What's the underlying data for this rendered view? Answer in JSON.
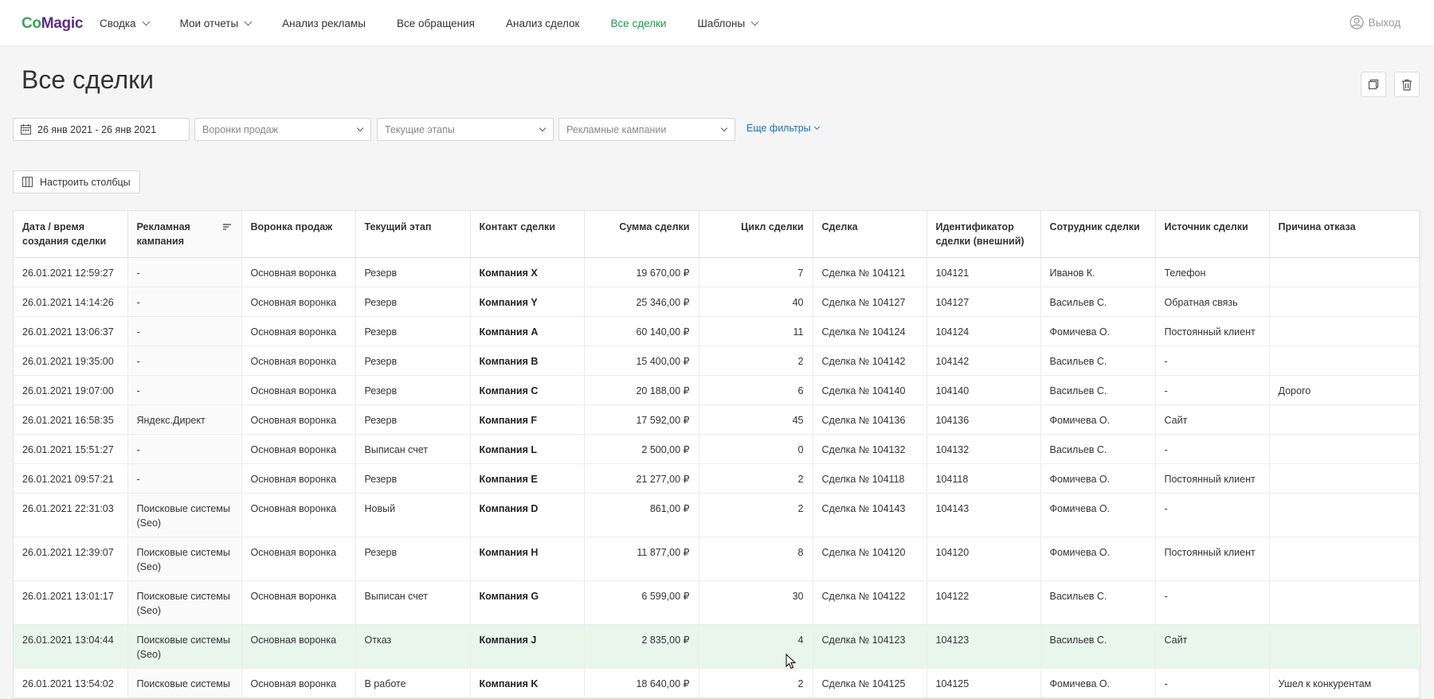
{
  "brand": {
    "part1": "Co",
    "part2": "Magic"
  },
  "nav": {
    "items": [
      {
        "label": "Сводка",
        "dropdown": true,
        "active": false
      },
      {
        "label": "Мои отчеты",
        "dropdown": true,
        "active": false
      },
      {
        "label": "Анализ рекламы",
        "dropdown": false,
        "active": false
      },
      {
        "label": "Все обращения",
        "dropdown": false,
        "active": false
      },
      {
        "label": "Анализ сделок",
        "dropdown": false,
        "active": false
      },
      {
        "label": "Все сделки",
        "dropdown": false,
        "active": true
      },
      {
        "label": "Шаблоны",
        "dropdown": true,
        "active": false
      }
    ],
    "logout_label": "Выход"
  },
  "page": {
    "title": "Все сделки"
  },
  "filters": {
    "date_range": "26 янв 2021 - 26 янв 2021",
    "funnels_placeholder": "Воронки продаж",
    "stages_placeholder": "Текущие этапы",
    "campaigns_placeholder": "Рекламные кампании",
    "more_label": "Еще фильтры"
  },
  "toolbar": {
    "columns_label": "Настроить столбцы"
  },
  "table": {
    "headers": [
      "Дата / время создания сделки",
      "Рекламная кампания",
      "Воронка продаж",
      "Текущий этап",
      "Контакт сделки",
      "Сумма сделки",
      "Цикл сделки",
      "Сделка",
      "Идентификатор сделки (внешний)",
      "Сотрудник сделки",
      "Источник сделки",
      "Причина отказа"
    ],
    "rows": [
      {
        "date": "26.01.2021 12:59:27",
        "campaign": "-",
        "funnel": "Основная воронка",
        "stage": "Резерв",
        "contact": "Компания X",
        "sum": "19 670,00 ₽",
        "cycle": "7",
        "deal": "Сделка № 104121",
        "ext_id": "104121",
        "employee": "Иванов К.",
        "source": "Телефон",
        "reason": ""
      },
      {
        "date": "26.01.2021 14:14:26",
        "campaign": "-",
        "funnel": "Основная воронка",
        "stage": "Резерв",
        "contact": "Компания Y",
        "sum": "25 346,00 ₽",
        "cycle": "40",
        "deal": "Сделка № 104127",
        "ext_id": "104127",
        "employee": "Васильев С.",
        "source": "Обратная связь",
        "reason": ""
      },
      {
        "date": "26.01.2021 13:06:37",
        "campaign": "-",
        "funnel": "Основная воронка",
        "stage": "Резерв",
        "contact": "Компания A",
        "sum": "60 140,00 ₽",
        "cycle": "11",
        "deal": "Сделка № 104124",
        "ext_id": "104124",
        "employee": "Фомичева О.",
        "source": "Постоянный клиент",
        "reason": ""
      },
      {
        "date": "26.01.2021 19:35:00",
        "campaign": "-",
        "funnel": "Основная воронка",
        "stage": "Резерв",
        "contact": "Компания B",
        "sum": "15 400,00 ₽",
        "cycle": "2",
        "deal": "Сделка № 104142",
        "ext_id": "104142",
        "employee": "Васильев С.",
        "source": "-",
        "reason": ""
      },
      {
        "date": "26.01.2021 19:07:00",
        "campaign": "-",
        "funnel": "Основная воронка",
        "stage": "Резерв",
        "contact": "Компания C",
        "sum": "20 188,00 ₽",
        "cycle": "6",
        "deal": "Сделка № 104140",
        "ext_id": "104140",
        "employee": "Васильев С.",
        "source": "-",
        "reason": "Дорого"
      },
      {
        "date": "26.01.2021 16:58:35",
        "campaign": "Яндекс.Директ",
        "funnel": "Основная воронка",
        "stage": "Резерв",
        "contact": "Компания F",
        "sum": "17 592,00 ₽",
        "cycle": "45",
        "deal": "Сделка № 104136",
        "ext_id": "104136",
        "employee": "Фомичева О.",
        "source": "Сайт",
        "reason": ""
      },
      {
        "date": "26.01.2021 15:51:27",
        "campaign": "-",
        "funnel": "Основная воронка",
        "stage": "Выписан счет",
        "contact": "Компания L",
        "sum": "2 500,00 ₽",
        "cycle": "0",
        "deal": "Сделка № 104132",
        "ext_id": "104132",
        "employee": "Васильев С.",
        "source": "-",
        "reason": ""
      },
      {
        "date": "26.01.2021 09:57:21",
        "campaign": "-",
        "funnel": "Основная воронка",
        "stage": "Резерв",
        "contact": "Компания E",
        "sum": "21 277,00 ₽",
        "cycle": "2",
        "deal": "Сделка № 104118",
        "ext_id": "104118",
        "employee": "Фомичева О.",
        "source": "Постоянный клиент",
        "reason": ""
      },
      {
        "date": "26.01.2021 22:31:03",
        "campaign": "Поисковые системы (Seo)",
        "funnel": "Основная воронка",
        "stage": "Новый",
        "contact": "Компания D",
        "sum": "861,00 ₽",
        "cycle": "2",
        "deal": "Сделка № 104143",
        "ext_id": "104143",
        "employee": "Фомичева О.",
        "source": "-",
        "reason": ""
      },
      {
        "date": "26.01.2021 12:39:07",
        "campaign": "Поисковые системы (Seo)",
        "funnel": "Основная воронка",
        "stage": "Резерв",
        "contact": "Компания H",
        "sum": "11 877,00 ₽",
        "cycle": "8",
        "deal": "Сделка № 104120",
        "ext_id": "104120",
        "employee": "Фомичева О.",
        "source": "Постоянный клиент",
        "reason": ""
      },
      {
        "date": "26.01.2021 13:01:17",
        "campaign": "Поисковые системы (Seo)",
        "funnel": "Основная воронка",
        "stage": "Выписан счет",
        "contact": "Компания G",
        "sum": "6 599,00 ₽",
        "cycle": "30",
        "deal": "Сделка № 104122",
        "ext_id": "104122",
        "employee": "Васильев С.",
        "source": "-",
        "reason": ""
      },
      {
        "date": "26.01.2021 13:04:44",
        "campaign": "Поисковые системы (Seo)",
        "funnel": "Основная воронка",
        "stage": "Отказ",
        "contact": "Компания J",
        "sum": "2 835,00 ₽",
        "cycle": "4",
        "deal": "Сделка № 104123",
        "ext_id": "104123",
        "employee": "Васильев С.",
        "source": "Сайт",
        "reason": "",
        "highlighted": true
      },
      {
        "date": "26.01.2021 13:54:02",
        "campaign": "Поисковые системы",
        "funnel": "Основная воронка",
        "stage": "В работе",
        "contact": "Компания K",
        "sum": "18 640,00 ₽",
        "cycle": "2",
        "deal": "Сделка № 104125",
        "ext_id": "104125",
        "employee": "Фомичева О.",
        "source": "-",
        "reason": "Ушел к конкурентам"
      }
    ]
  },
  "colors": {
    "accent_green": "#1b9e4b",
    "link_blue": "#1a73b6",
    "highlight_row": "#e8f6ec"
  }
}
